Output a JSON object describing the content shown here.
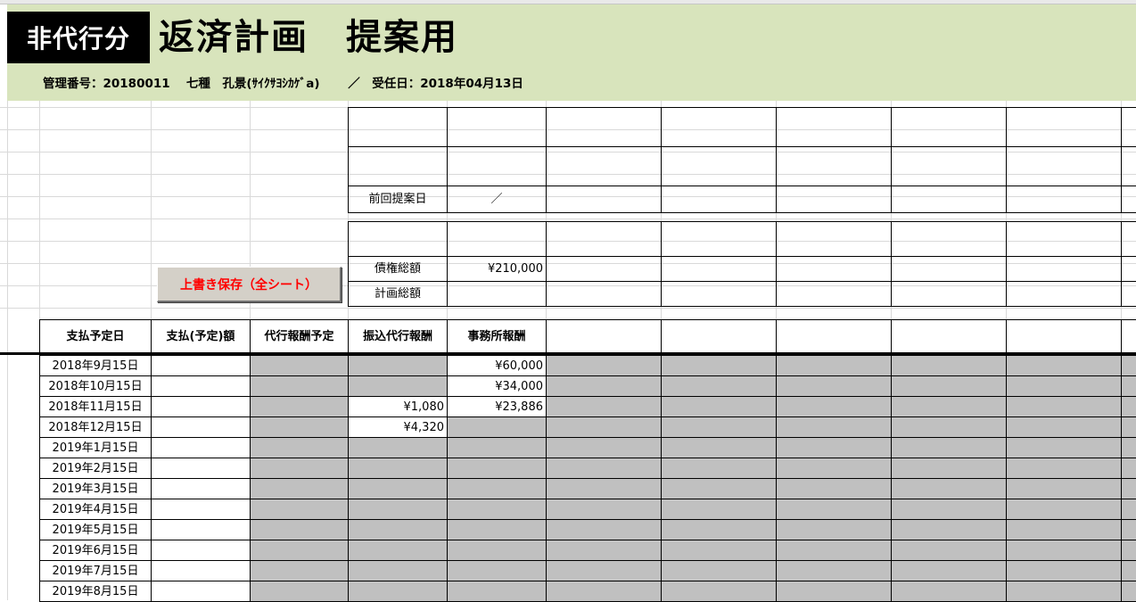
{
  "banner": {
    "badge": "非代行分",
    "title": "返済計画　提案用",
    "info": "管理番号：20180011　 七種　孔景(ｻｲｸｻﾖｼｶｹﾞa)　　 ／　受任日：2018年04月13日",
    "background_color": "#d8e4bc"
  },
  "summary": {
    "prev_proposal_label": "前回提案日",
    "prev_proposal_value": "／",
    "claim_total_label": "債権総額",
    "claim_total_value": "¥210,000",
    "plan_total_label": "計画総額",
    "plan_total_value": ""
  },
  "save_button": {
    "label": "上書き保存（全シート）",
    "color": "#ff0000"
  },
  "table": {
    "headers": [
      "支払予定日",
      "支払(予定)額",
      "代行報酬予定",
      "振込代行報酬",
      "事務所報酬"
    ],
    "rows": [
      {
        "date": "2018年9月15日",
        "transfer_fee": "",
        "office_fee": "¥60,000"
      },
      {
        "date": "2018年10月15日",
        "transfer_fee": "",
        "office_fee": "¥34,000"
      },
      {
        "date": "2018年11月15日",
        "transfer_fee": "¥1,080",
        "office_fee": "¥23,886"
      },
      {
        "date": "2018年12月15日",
        "transfer_fee": "¥4,320",
        "office_fee": ""
      },
      {
        "date": "2019年1月15日",
        "transfer_fee": "",
        "office_fee": ""
      },
      {
        "date": "2019年2月15日",
        "transfer_fee": "",
        "office_fee": ""
      },
      {
        "date": "2019年3月15日",
        "transfer_fee": "",
        "office_fee": ""
      },
      {
        "date": "2019年4月15日",
        "transfer_fee": "",
        "office_fee": ""
      },
      {
        "date": "2019年5月15日",
        "transfer_fee": "",
        "office_fee": ""
      },
      {
        "date": "2019年6月15日",
        "transfer_fee": "",
        "office_fee": ""
      },
      {
        "date": "2019年7月15日",
        "transfer_fee": "",
        "office_fee": ""
      },
      {
        "date": "2019年8月15日",
        "transfer_fee": "",
        "office_fee": ""
      }
    ],
    "shade_color": "#c0c0c0"
  }
}
